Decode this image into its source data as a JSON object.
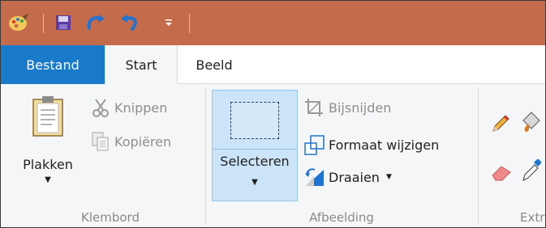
{
  "quick_access": {
    "icons": [
      "paint-app-icon",
      "save-icon",
      "redo-icon",
      "undo-icon",
      "customize-dropdown-icon"
    ]
  },
  "tabs": [
    {
      "label": "Bestand"
    },
    {
      "label": "Start"
    },
    {
      "label": "Beeld"
    }
  ],
  "clipboard": {
    "paste_label": "Plakken",
    "cut_label": "Knippen",
    "copy_label": "Kopiëren",
    "group_label": "Klembord"
  },
  "image": {
    "select_label": "Selecteren",
    "crop_label": "Bijsnijden",
    "resize_label": "Formaat wijzigen",
    "rotate_label": "Draaien",
    "group_label": "Afbeelding"
  },
  "tools": {
    "group_label": "Extr",
    "icons": [
      "pencil-icon",
      "fill-bucket-icon",
      "eraser-icon",
      "color-picker-icon"
    ]
  },
  "colors": {
    "titlebar": "#c46b4b",
    "file_tab": "#1979ca",
    "selected_button": "#cce4f7"
  }
}
